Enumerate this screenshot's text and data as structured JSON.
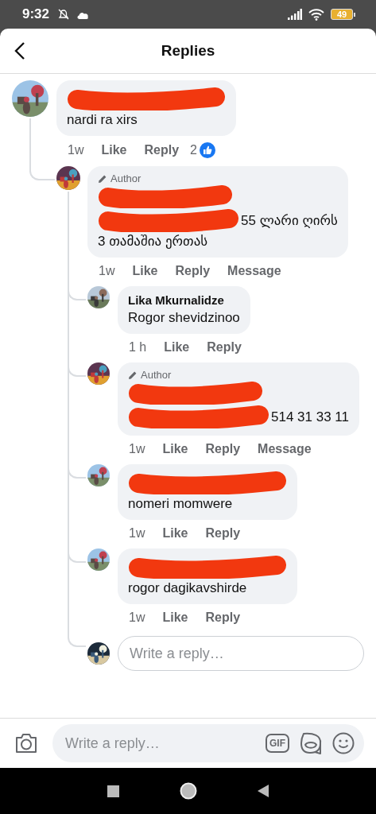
{
  "status_bar": {
    "time": "9:32",
    "battery": "49"
  },
  "header": {
    "title": "Replies"
  },
  "comments": [
    {
      "kind": "comment",
      "name_redacted": true,
      "lines": [
        {
          "text": "nardi ra xirs",
          "redacted_before": false
        }
      ],
      "time": "1w",
      "actions": [
        "Like",
        "Reply"
      ],
      "reactions": "2",
      "children": [
        {
          "kind": "comment",
          "badge": "Author",
          "name_redacted": true,
          "lines": [
            {
              "text": "55 ლარი ღირს",
              "redacted_before": true
            },
            {
              "text": "3 თამაშია ერთას",
              "redacted_before": false
            }
          ],
          "time": "1w",
          "actions": [
            "Like",
            "Reply",
            "Message"
          ],
          "children": [
            {
              "kind": "comment",
              "author": "Lika Mkurnalidze",
              "name_redacted": false,
              "lines": [
                {
                  "text": "Rogor shevidzinoo",
                  "redacted_before": false
                }
              ],
              "time": "1 h",
              "actions": [
                "Like",
                "Reply"
              ]
            },
            {
              "kind": "comment",
              "badge": "Author",
              "name_redacted": true,
              "lines": [
                {
                  "text": "514 31 33 11",
                  "redacted_before": true
                }
              ],
              "time": "1w",
              "actions": [
                "Like",
                "Reply",
                "Message"
              ]
            },
            {
              "kind": "comment",
              "name_redacted": true,
              "lines": [
                {
                  "text": "nomeri momwere",
                  "redacted_before": false
                }
              ],
              "time": "1w",
              "actions": [
                "Like",
                "Reply"
              ]
            },
            {
              "kind": "comment",
              "name_redacted": true,
              "lines": [
                {
                  "text": "rogor dagikavshirde",
                  "redacted_before": false
                }
              ],
              "time": "1w",
              "actions": [
                "Like",
                "Reply"
              ]
            },
            {
              "kind": "reply_box",
              "placeholder": "Write a reply…"
            }
          ]
        }
      ]
    }
  ],
  "composer": {
    "placeholder": "Write a reply…",
    "gif_label": "GIF"
  }
}
